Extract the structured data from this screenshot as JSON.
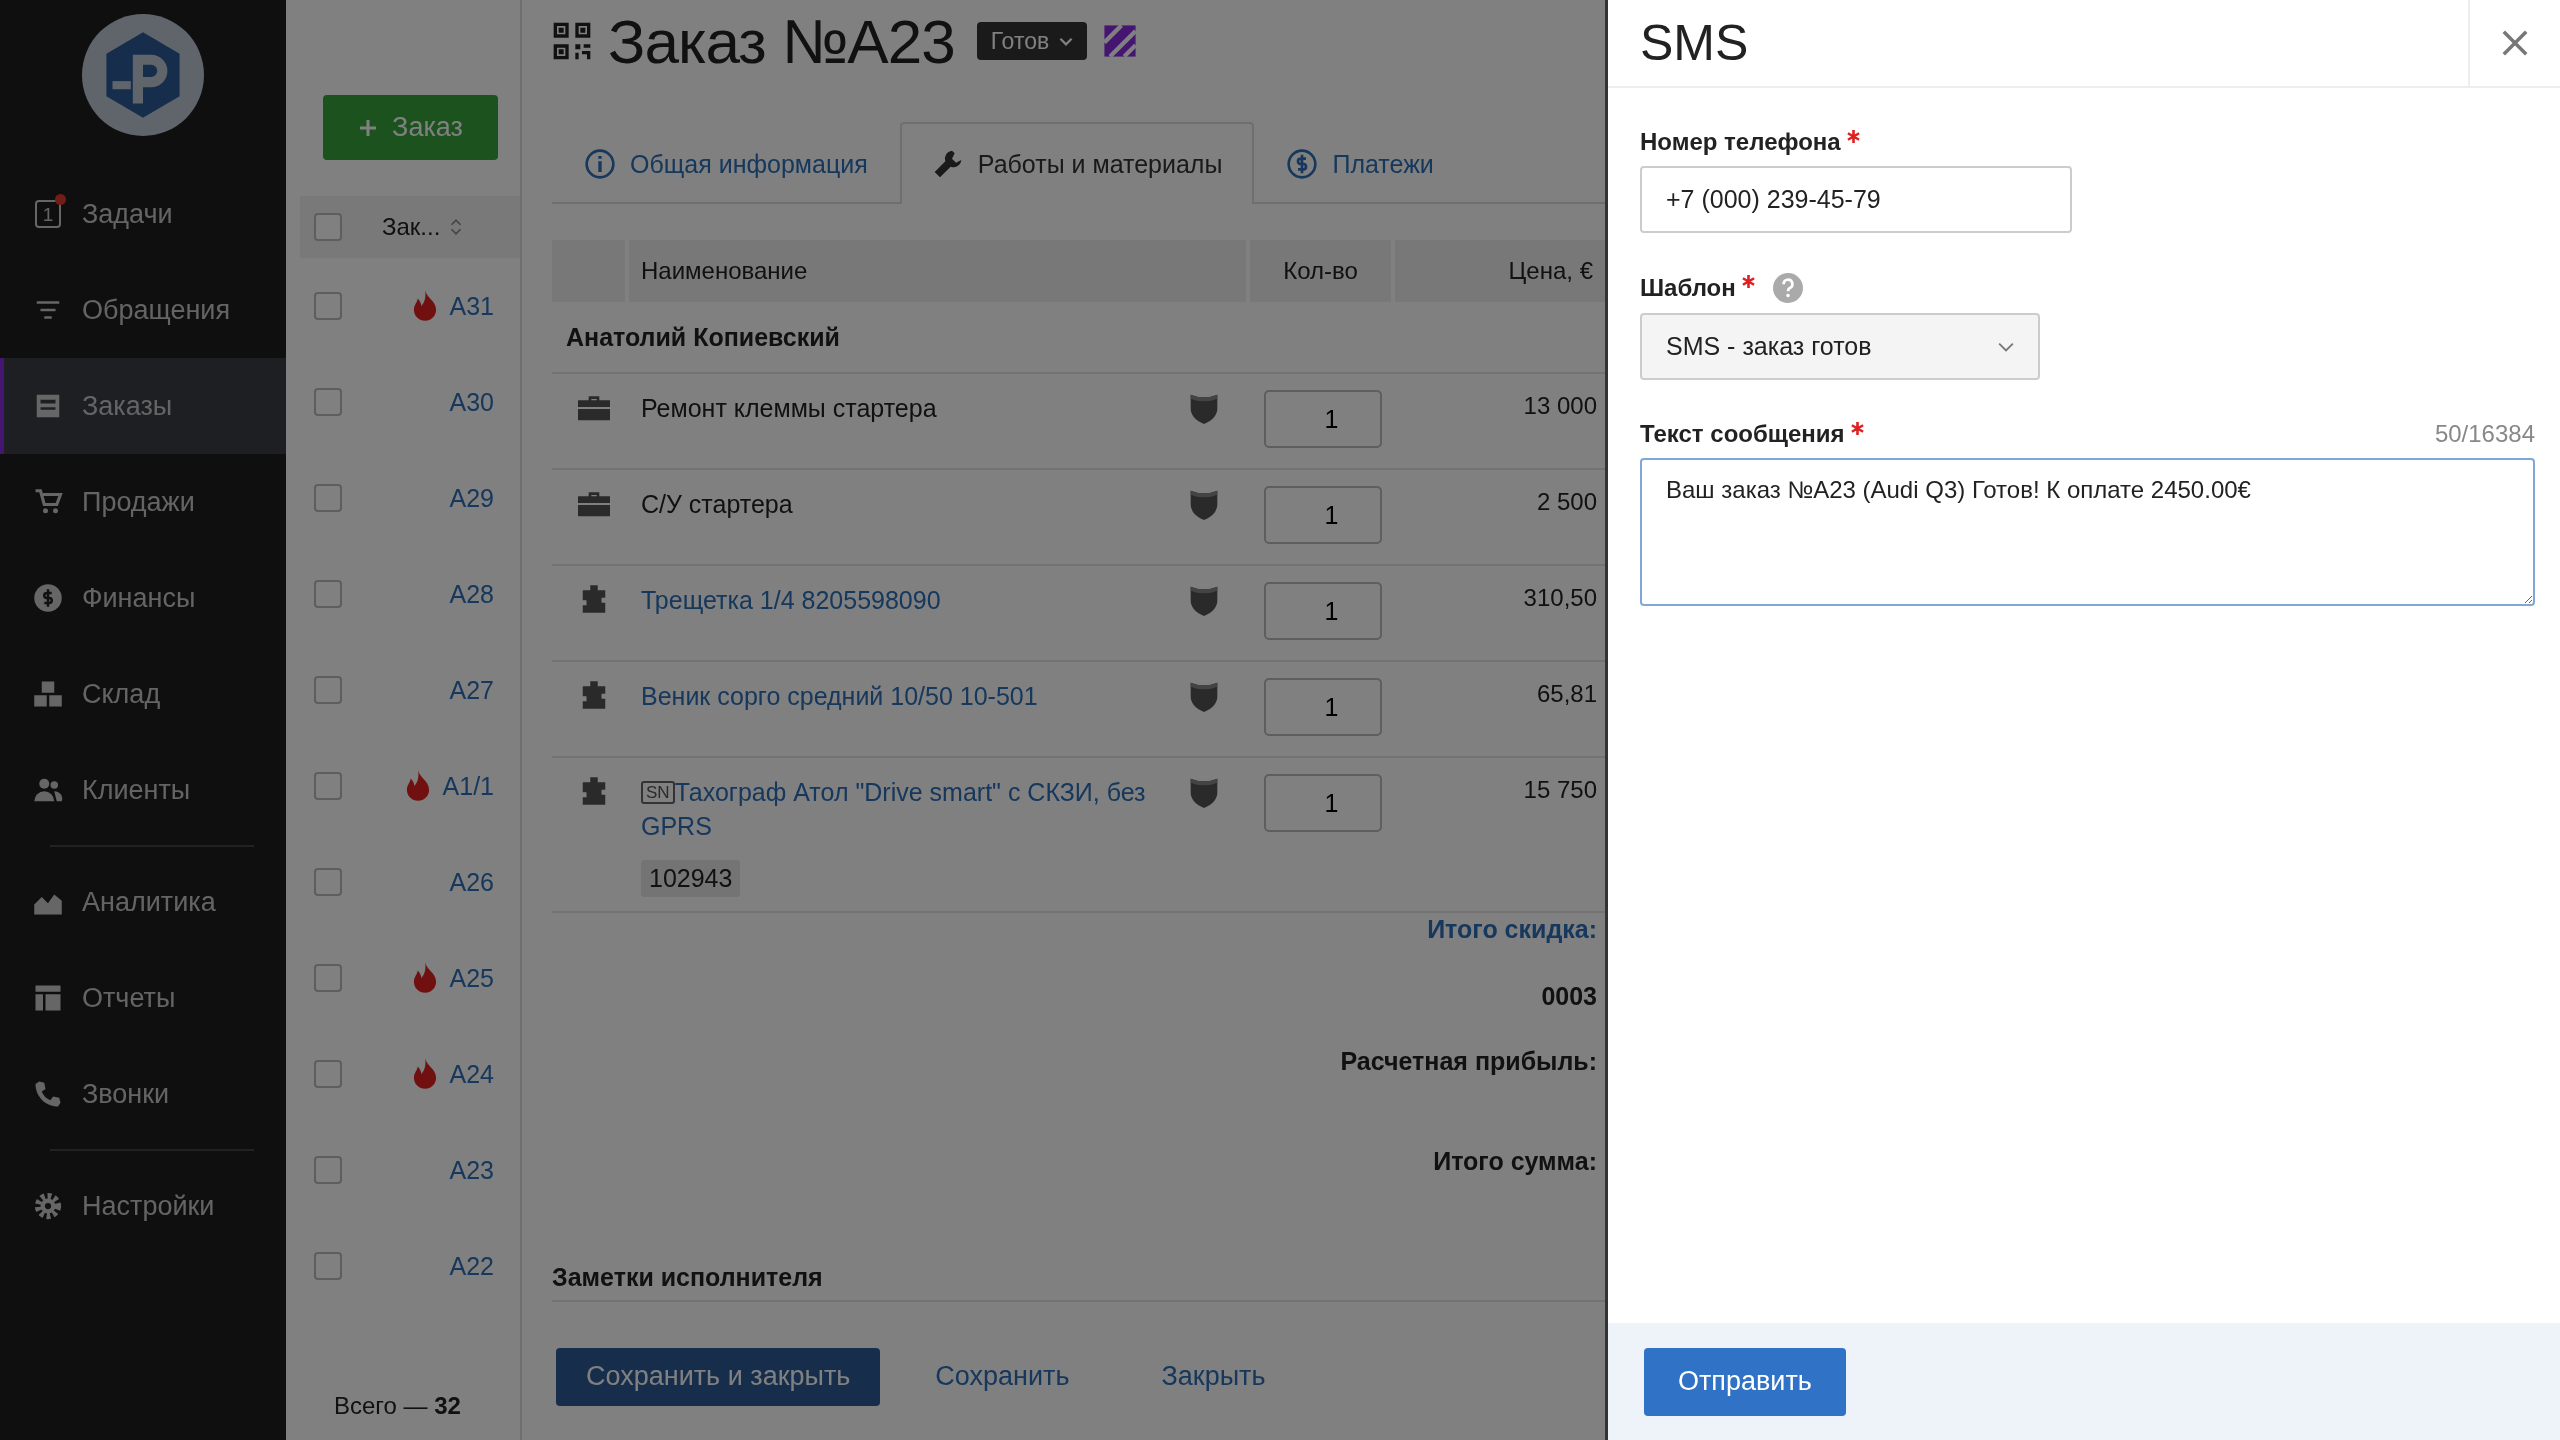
{
  "sidebar": {
    "groups": [
      [
        {
          "label": "Задачи",
          "badge": "1",
          "notification": true,
          "selected": false
        },
        {
          "label": "Обращения",
          "notification": false,
          "selected": false
        },
        {
          "label": "Заказы",
          "notification": false,
          "selected": true
        },
        {
          "label": "Продажи",
          "notification": false,
          "selected": false
        },
        {
          "label": "Финансы",
          "notification": false,
          "selected": false
        },
        {
          "label": "Склад",
          "notification": false,
          "selected": false
        },
        {
          "label": "Клиенты",
          "notification": false,
          "selected": false
        }
      ],
      [
        {
          "label": "Аналитика",
          "notification": false,
          "selected": false
        },
        {
          "label": "Отчеты",
          "notification": false,
          "selected": false
        },
        {
          "label": "Звонки",
          "notification": false,
          "selected": false
        }
      ],
      [
        {
          "label": "Настройки",
          "notification": false,
          "selected": false
        }
      ]
    ]
  },
  "orders_list": {
    "new_button": "Заказ",
    "header": "Зак...",
    "header_checked": false,
    "rows": [
      {
        "number": "A31",
        "urgent": true,
        "checked": false
      },
      {
        "number": "A30",
        "urgent": false,
        "checked": false
      },
      {
        "number": "A29",
        "urgent": false,
        "checked": false
      },
      {
        "number": "A28",
        "urgent": false,
        "checked": false
      },
      {
        "number": "A27",
        "urgent": false,
        "checked": false
      },
      {
        "number": "A1/1",
        "urgent": true,
        "checked": false
      },
      {
        "number": "A26",
        "urgent": false,
        "checked": false
      },
      {
        "number": "A25",
        "urgent": true,
        "checked": false
      },
      {
        "number": "A24",
        "urgent": true,
        "checked": false
      },
      {
        "number": "A23",
        "urgent": false,
        "checked": false
      },
      {
        "number": "A22",
        "urgent": false,
        "checked": false
      }
    ],
    "total": "Всего — **32**"
  },
  "order": {
    "title": "Заказ №A23",
    "status": "Готов",
    "tabs": [
      {
        "label": "Общая информация",
        "selected": false
      },
      {
        "label": "Работы и материалы",
        "selected": true
      },
      {
        "label": "Платежи",
        "selected": false
      }
    ],
    "table": {
      "columns": [
        "Наименование",
        "Кол-во",
        "Цена, €"
      ],
      "group": "Анатолий Копиевский",
      "rows": [
        {
          "kind": "service",
          "name": "Ремонт клеммы стартера",
          "qty": "1",
          "price": "13 000"
        },
        {
          "kind": "service",
          "name": "С/У стартера",
          "qty": "1",
          "price": "2 500"
        },
        {
          "kind": "part",
          "name": "Трещетка 1/4 8205598090",
          "qty": "1",
          "price": "310,50"
        },
        {
          "kind": "part",
          "name": "Веник сорго средний 10/50 10-501",
          "qty": "1",
          "price": "65,81"
        },
        {
          "kind": "part",
          "tag": "SN",
          "name": "Тахограф Атол \"Drive smart\" с СКЗИ, без GPRS",
          "serial": "102943",
          "qty": "1",
          "price": "15 750"
        }
      ]
    },
    "totals": [
      {
        "kind": "link",
        "text": "Итого скидка:"
      },
      {
        "kind": "value",
        "text": "0003"
      },
      {
        "kind": "label",
        "text": "Расчетная прибыль:"
      },
      {
        "kind": "label",
        "text": "Итого сумма:"
      }
    ],
    "notes_heading": "Заметки исполнителя",
    "buttons": [
      {
        "kind": "primary",
        "label": "Сохранить и закрыть"
      },
      {
        "kind": "link",
        "label": "Сохранить"
      },
      {
        "kind": "link",
        "label": "Закрыть"
      }
    ]
  },
  "sms": {
    "title": "SMS",
    "phone": {
      "label": "Номер телефона",
      "required": true,
      "value": "+7 (000) 239-45-79"
    },
    "template": {
      "label": "Шаблон",
      "required": true,
      "value": "SMS - заказ готов"
    },
    "message": {
      "label": "Текст сообщения",
      "required": true,
      "counter": "50/16384",
      "value": "Ваш заказ №A23 (Audi Q3) Готов! К оплате 2450.00€"
    },
    "send_button": "Отправить"
  }
}
